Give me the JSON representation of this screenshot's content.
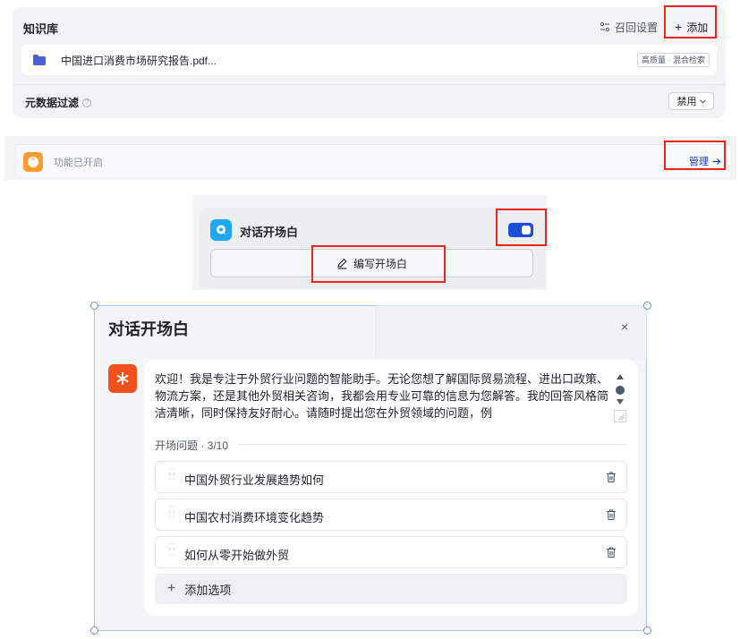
{
  "knowledge": {
    "title": "知识库",
    "recall_label": "召回设置",
    "add_label": "添加",
    "item": {
      "name": "中国进口消费市场研究报告.pdf...",
      "tag": "高质量 · 混合检索"
    },
    "metadata_label": "元数据过滤",
    "metadata_select": "禁用"
  },
  "feature": {
    "status_label": "功能已开启",
    "manage_label": "管理"
  },
  "opener": {
    "title": "对话开场白",
    "toggle_on": true,
    "write_label": "编写开场白"
  },
  "modal": {
    "title": "对话开场白",
    "close_label": "×",
    "message": "欢迎！我是专注于外贸行业问题的智能助手。无论您想了解国际贸易流程、进出口政策、物流方案，还是其他外贸相关咨询，我都会用专业可靠的信息为您解答。我的回答风格简洁清晰，同时保持友好耐心。请随时提出您在外贸领域的问题，例",
    "questions_header": "开场问题 · 3/10",
    "questions": [
      "中国外贸行业发展趋势如何",
      "中国农村消费环境变化趋势",
      "如何从零开始做外贸"
    ],
    "add_option_label": "添加选项"
  },
  "colors": {
    "accent_blue": "#1d4ed8",
    "highlight_red": "#e8261c",
    "bot_orange": "#f5511e"
  }
}
